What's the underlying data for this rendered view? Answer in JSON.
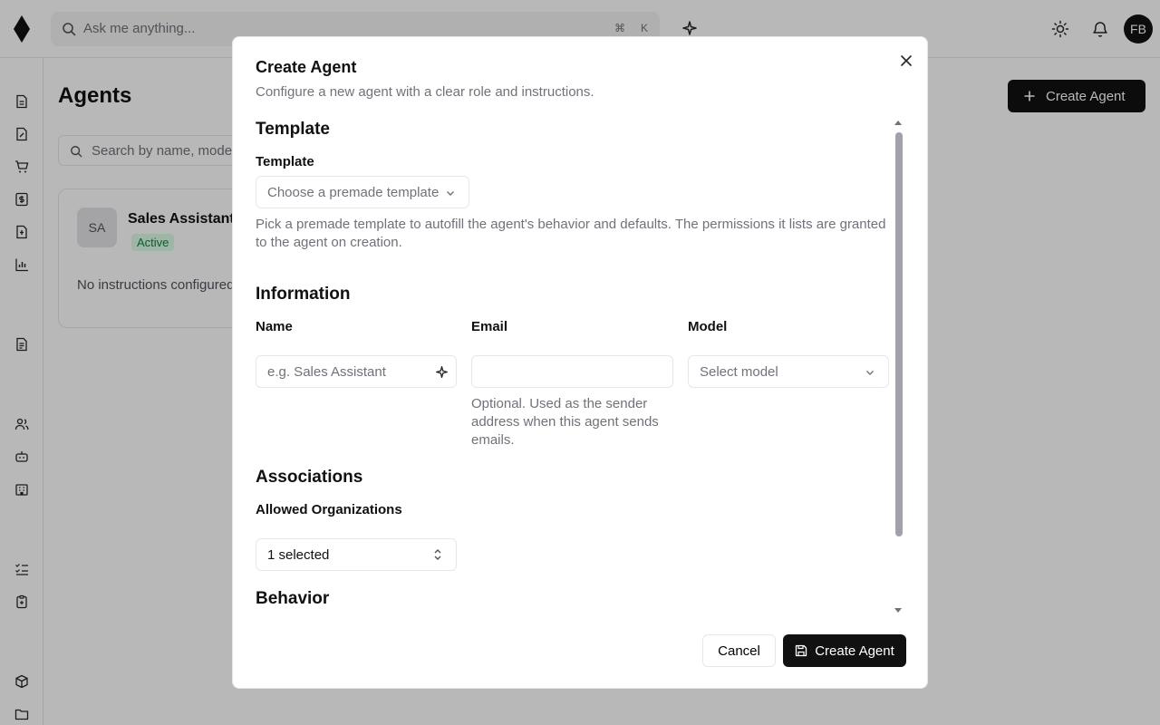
{
  "topbar": {
    "search_placeholder": "Ask me anything...",
    "shortcut_cmd": "⌘",
    "shortcut_key": "K",
    "user_initials": "FB"
  },
  "page": {
    "title": "Agents",
    "create_button_label": "Create Agent",
    "search_placeholder": "Search by name, model...",
    "agent_card": {
      "initials": "SA",
      "name": "Sales Assistant",
      "status": "Active",
      "instructions": "No instructions configured"
    }
  },
  "modal": {
    "title": "Create Agent",
    "description": "Configure a new agent with a clear role and instructions.",
    "template_section": {
      "heading": "Template",
      "label": "Template",
      "placeholder": "Choose a premade template",
      "help": "Pick a premade template to autofill the agent's behavior and defaults. The permissions it lists are granted to the agent on creation."
    },
    "information_section": {
      "heading": "Information",
      "name_label": "Name",
      "name_placeholder": "e.g. Sales Assistant",
      "email_label": "Email",
      "email_value": "",
      "email_help": "Optional. Used as the sender address when this agent sends emails.",
      "model_label": "Model",
      "model_placeholder": "Select model"
    },
    "associations_section": {
      "heading": "Associations",
      "orgs_label": "Allowed Organizations",
      "orgs_value": "1 selected"
    },
    "behavior_section": {
      "heading": "Behavior"
    },
    "cancel_label": "Cancel",
    "submit_label": "Create Agent"
  },
  "colors": {
    "primary": "#111111",
    "muted_text": "#71717a",
    "border": "#e5e7eb",
    "active_badge_bg": "#dcfce7",
    "active_badge_text": "#15803d"
  }
}
